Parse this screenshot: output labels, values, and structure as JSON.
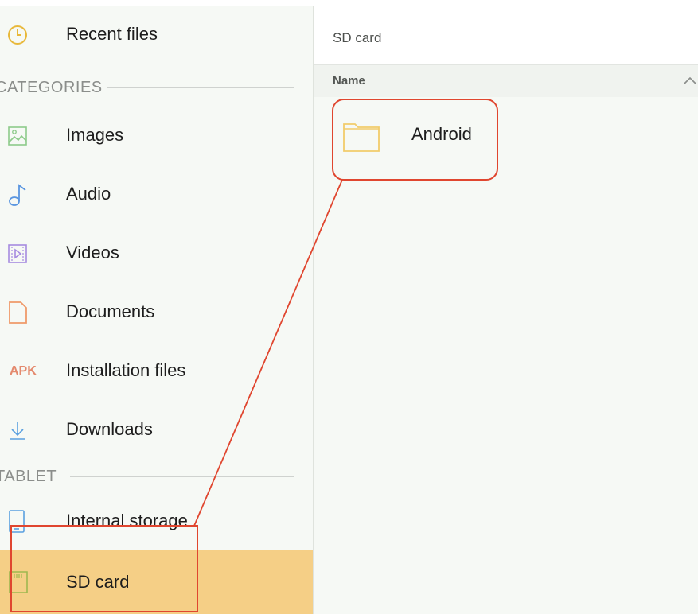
{
  "sidebar": {
    "recent": {
      "label": "Recent files",
      "icon": "clock-icon"
    },
    "categories_header": "CATEGORIES",
    "categories": [
      {
        "id": "images",
        "label": "Images",
        "icon": "image-icon"
      },
      {
        "id": "audio",
        "label": "Audio",
        "icon": "music-note-icon"
      },
      {
        "id": "videos",
        "label": "Videos",
        "icon": "video-icon"
      },
      {
        "id": "documents",
        "label": "Documents",
        "icon": "document-icon"
      },
      {
        "id": "installation",
        "label": "Installation files",
        "icon": "apk-icon",
        "icon_text": "APK"
      },
      {
        "id": "downloads",
        "label": "Downloads",
        "icon": "download-icon"
      }
    ],
    "tablet_header": "TABLET",
    "storage": [
      {
        "id": "internal",
        "label": "Internal storage",
        "icon": "tablet-icon"
      },
      {
        "id": "sdcard",
        "label": "SD card",
        "icon": "sd-card-icon",
        "selected": true
      }
    ]
  },
  "main": {
    "title": "SD card",
    "column_name": "Name",
    "sort_icon": "chevron-up-icon",
    "files": [
      {
        "name": "Android",
        "icon": "folder-icon"
      }
    ]
  },
  "colors": {
    "selected_bg": "#f5cf86",
    "annotation": "#e0462f",
    "folder": "#f2cc6b"
  }
}
